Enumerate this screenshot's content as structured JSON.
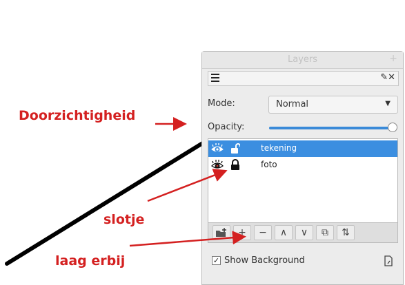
{
  "panel": {
    "title": "Layers",
    "title_plus": "+",
    "tools_icons": "✎✕",
    "mode_label": "Mode:",
    "mode_value": "Normal",
    "opacity_label": "Opacity:",
    "opacity_level": 1.0,
    "layers": [
      {
        "name": "tekening",
        "visible": true,
        "locked": false,
        "selected": true
      },
      {
        "name": "foto",
        "visible": true,
        "locked": true,
        "selected": false
      }
    ],
    "buttons": [
      "+",
      "−",
      "∧",
      "∨",
      "⧉",
      "⇅"
    ],
    "show_background_label": "Show Background",
    "show_background_checked": true,
    "show_background_check": "✓"
  },
  "annotations": {
    "transparency": "Doorzichtigheid",
    "lock": "slotje",
    "add_layer": "laag erbij"
  },
  "colors": {
    "accent": "#3b8ee0",
    "annotation": "#d42020"
  }
}
